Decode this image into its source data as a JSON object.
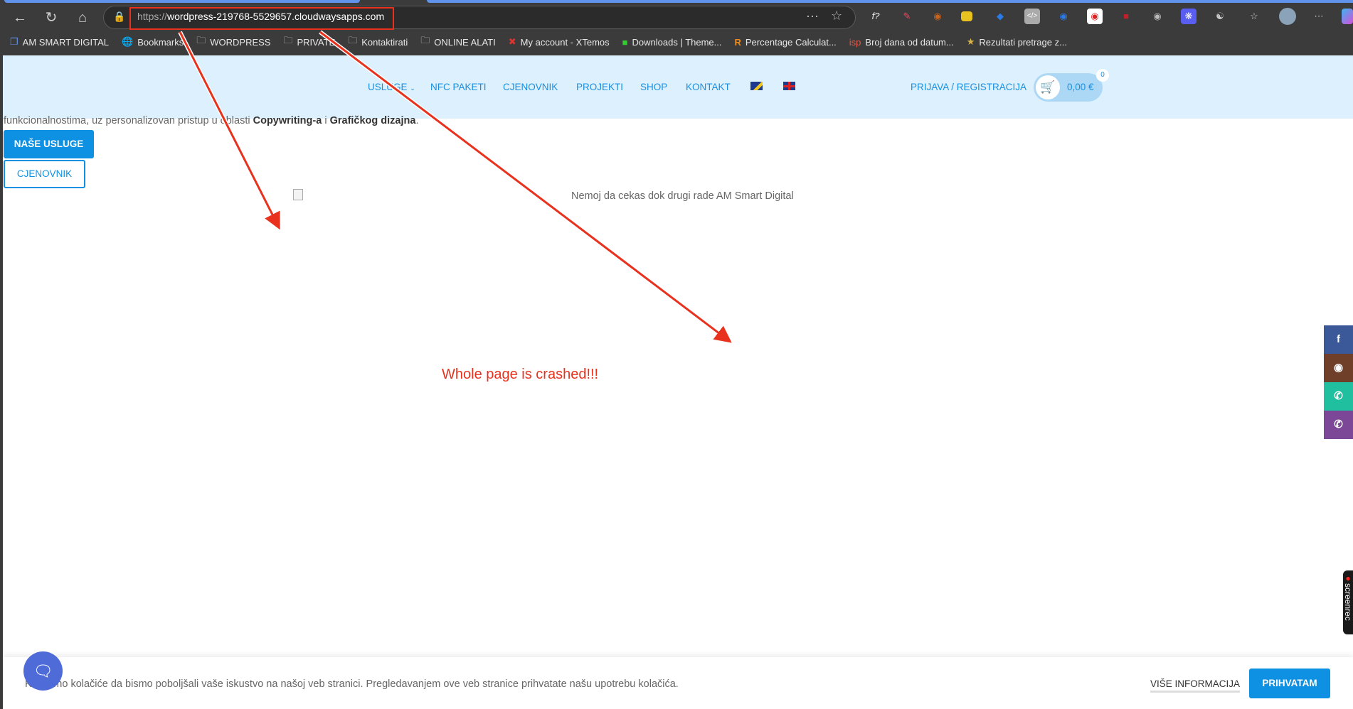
{
  "browser": {
    "url_scheme": "https://",
    "url_host": "wordpress-219768-5529657.cloudwaysapps.com",
    "bookmarks": [
      "AM SMART DIGITAL",
      "Bookmarks",
      "WORDPRESS",
      "PRIVATE",
      "Kontaktirati",
      "ONLINE ALATI",
      "My account - XTemos",
      "Downloads | Theme...",
      "Percentage Calculat...",
      "Broj dana od datum...",
      "Rezultati pretrage z..."
    ],
    "ext_label": "f?"
  },
  "header": {
    "nav": [
      "USLUGE",
      "NFC PAKETI",
      "CJENOVNIK",
      "PROJEKTI",
      "SHOP",
      "KONTAKT"
    ],
    "login": "PRIJAVA / REGISTRACIJA",
    "cart_amount": "0,00 €",
    "cart_count": "0"
  },
  "main": {
    "intro_start": "funkcionalnostima, uz personalizovan pristup u oblasti ",
    "intro_b1": "Copywriting-a",
    "intro_mid": " i ",
    "intro_b2": "Grafičkog dizajna",
    "intro_end": ".",
    "btn_services": "NAŠE USLUGE",
    "btn_prices": "CJENOVNIK",
    "image_alt": "Nemoj da cekas dok drugi rade AM Smart Digital"
  },
  "annotation": {
    "text": "Whole page is crashed!!!",
    "color": "#e8321e"
  },
  "screenrec": "screenrec",
  "cookie": {
    "text": "Koristimo kolačiće da bismo poboljšali vaše iskustvo na našoj veb stranici. Pregledavanjem ove veb stranice prihvatate našu upotrebu kolačića.",
    "more": "VIŠE INFORMACIJA",
    "accept": "PRIHVATAM"
  },
  "colors": {
    "accent": "#0e91e3",
    "header_bg": "#dcf0fd"
  }
}
